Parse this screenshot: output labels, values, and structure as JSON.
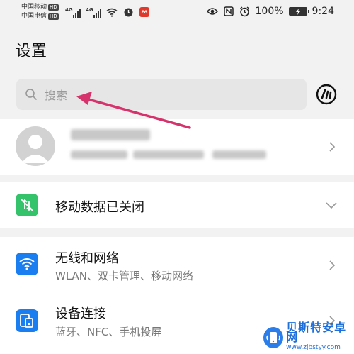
{
  "status_bar": {
    "carrier1": "中国移动",
    "carrier2": "中国电信",
    "hd_badge": "HD",
    "network_gen": "4G",
    "battery_percent": "100%",
    "time": "9:24"
  },
  "page": {
    "title": "设置"
  },
  "search": {
    "placeholder": "搜索"
  },
  "account": {
    "name_hidden": true
  },
  "mobile_data": {
    "title": "移动数据已关闭",
    "icon_color": "#34c26b"
  },
  "items": [
    {
      "title": "无线和网络",
      "subtitle": "WLAN、双卡管理、移动网络",
      "icon": "wifi-icon",
      "icon_color": "#1a7df0"
    },
    {
      "title": "设备连接",
      "subtitle": "蓝牙、NFC、手机投屏",
      "icon": "device-connect-icon",
      "icon_color": "#1a7df0"
    }
  ],
  "annotation": {
    "arrow_color": "#d6336c"
  },
  "watermark": {
    "name": "贝斯特安卓网",
    "url": "www.zjbstyy.com"
  }
}
